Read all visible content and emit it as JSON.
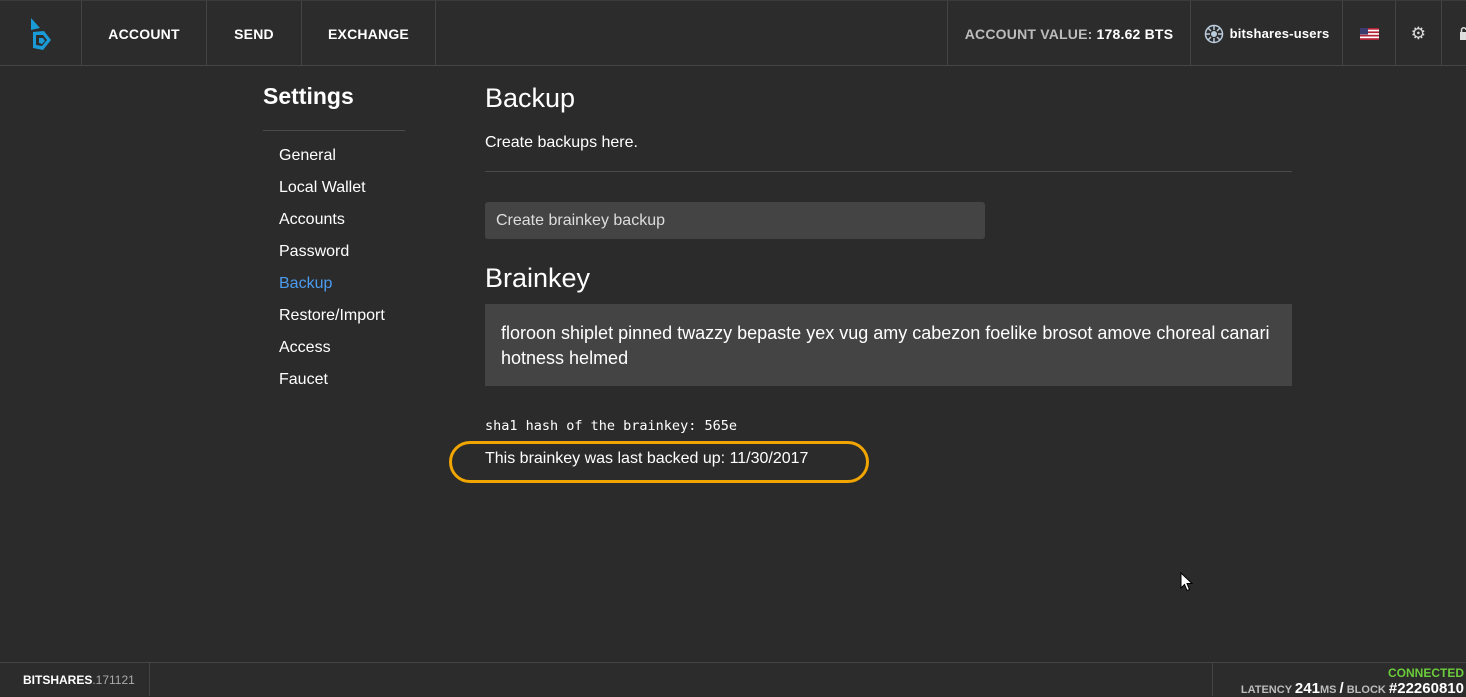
{
  "header": {
    "nav": [
      "ACCOUNT",
      "SEND",
      "EXCHANGE"
    ],
    "account_value_label": "ACCOUNT VALUE:",
    "account_value": "178.62 BTS",
    "username": "bitshares-users",
    "icons": [
      "bitshares-logo-icon",
      "user-icon",
      "us-flag-icon",
      "gear-icon",
      "lock-icon"
    ]
  },
  "sidebar": {
    "title": "Settings",
    "items": [
      "General",
      "Local Wallet",
      "Accounts",
      "Password",
      "Backup",
      "Restore/Import",
      "Access",
      "Faucet"
    ],
    "active": "Backup"
  },
  "main": {
    "title": "Backup",
    "subtitle": "Create backups here.",
    "backup_option": "Create brainkey backup",
    "brainkey_title": "Brainkey",
    "brainkey_words": "floroon shiplet pinned twazzy bepaste yex vug amy cabezon foelike brosot amove choreal canari hotness helmed",
    "hash_text": "sha1 hash of the brainkey: 565e",
    "last_backup_text": "This brainkey was last backed up: 11/30/2017"
  },
  "footer": {
    "version_name": "BITSHARES",
    "version_num": ".171121",
    "status": "CONNECTED",
    "latency_label": "LATENCY",
    "latency_value": "241",
    "latency_unit": "MS",
    "block_label": "BLOCK",
    "block_value": "#22260810"
  },
  "colors": {
    "background": "#2b2b2b",
    "panel": "#444444",
    "active_link": "#4b9cf0",
    "highlight": "#f0a500",
    "connected": "#6bcc3b"
  }
}
